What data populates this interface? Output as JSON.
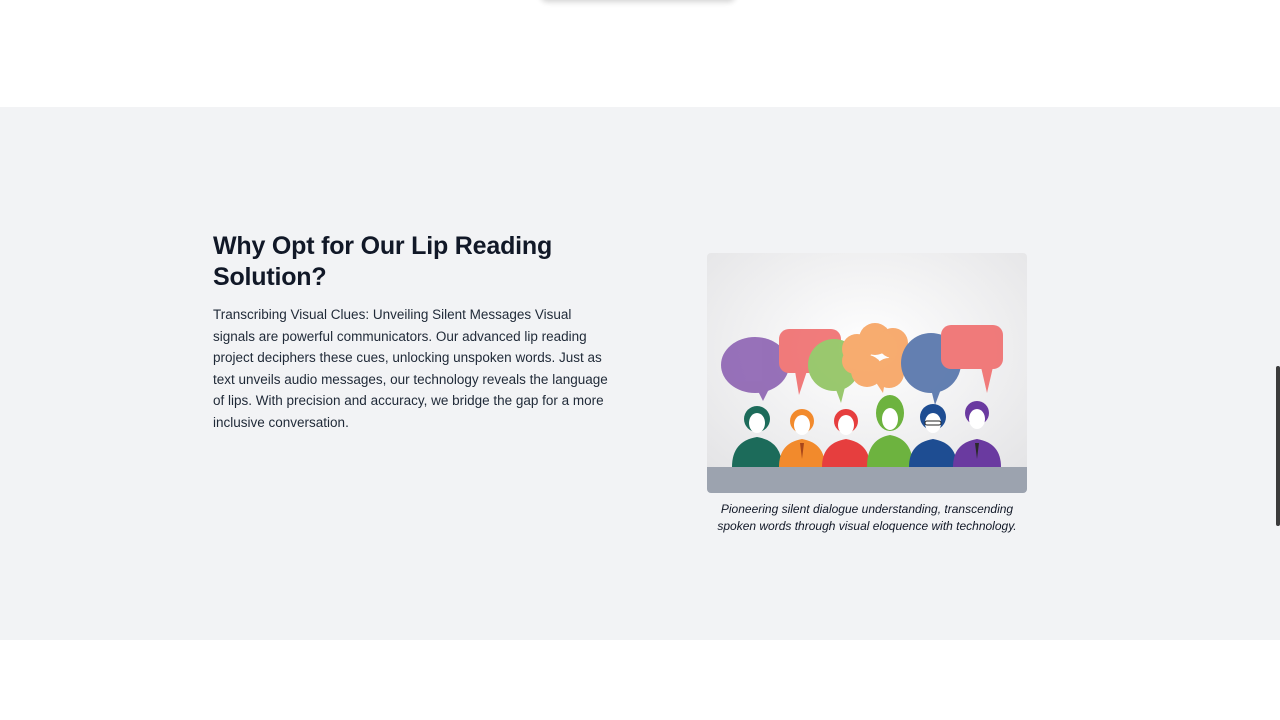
{
  "section": {
    "heading": "Why Opt for Our Lip Reading Solution?",
    "body": "Transcribing Visual Clues: Unveiling Silent Messages Visual signals are powerful communicators. Our advanced lip reading project deciphers these cues, unlocking unspoken words. Just as text unveils audio messages, our technology reveals the language of lips. With precision and accuracy, we bridge the gap for a more inclusive conversation.",
    "figure": {
      "image_icon": "people-speech-bubbles-illustration",
      "caption": "Pioneering silent dialogue understanding, transcending spoken words through visual eloquence with technology."
    }
  },
  "colors": {
    "section_bg": "#f2f3f5",
    "heading": "#111827",
    "bubble_purple": "#8a5fb0",
    "bubble_red": "#f06a6a",
    "bubble_green": "#8dc25b",
    "bubble_orange": "#f7a15c",
    "bubble_blue": "#4f6fa8"
  }
}
